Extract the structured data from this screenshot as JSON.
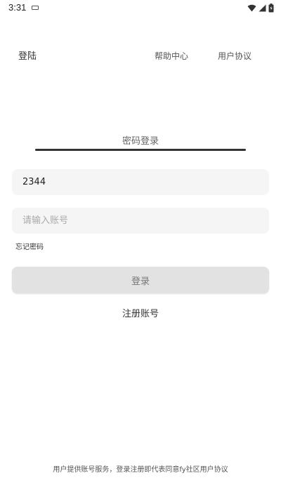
{
  "status_bar": {
    "time": "3:31",
    "icons": [
      "keyboard-icon",
      "wifi-icon",
      "signal-icon",
      "battery-icon"
    ]
  },
  "header": {
    "title": "登陆",
    "help_label": "帮助中心",
    "agreement_label": "用户协议"
  },
  "tab": {
    "label": "密码登录",
    "indicator_color": "#333333"
  },
  "form": {
    "field1_value": "2344",
    "field2_value": "",
    "field2_placeholder": "请输入账号",
    "forgot_label": "忘记密码",
    "login_label": "登录",
    "register_label": "注册账号"
  },
  "footer": {
    "text": "用户提供账号服务，登录注册即代表同意fy社区用户协议"
  },
  "colors": {
    "input_bg": "#f5f5f5",
    "button_bg": "#e2e2e2"
  }
}
